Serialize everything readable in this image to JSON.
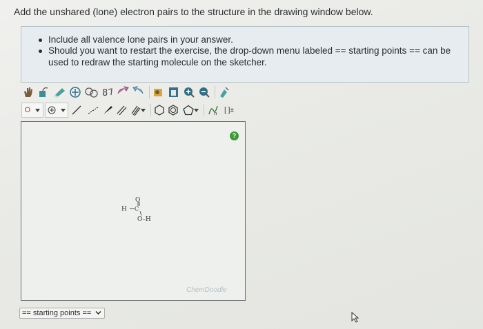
{
  "question": {
    "text": "Add the unshared (lone) electron pairs to the structure in the drawing window below."
  },
  "instructions": {
    "items": [
      {
        "line1": "Include all valence lone pairs in your answer.",
        "line2": ""
      },
      {
        "line1": "Should you want to restart the exercise, the drop-down menu labeled == starting points == can be",
        "line2": "used to redraw the starting molecule on the sketcher."
      }
    ]
  },
  "toolbar": {
    "atom_label": "O",
    "template_label": "[ ]±"
  },
  "canvas": {
    "help_symbol": "?",
    "watermark": "ChemDoodle",
    "molecule": {
      "atom_o_top": "O",
      "atom_h_left": "H",
      "atom_c": "C",
      "atom_oh": "O–H"
    }
  },
  "starting_points": {
    "label": "== starting points =="
  },
  "colors": {
    "info_box_bg": "#e6ecef",
    "help_green": "#3c9a35",
    "canvas_border": "#6e7274"
  }
}
